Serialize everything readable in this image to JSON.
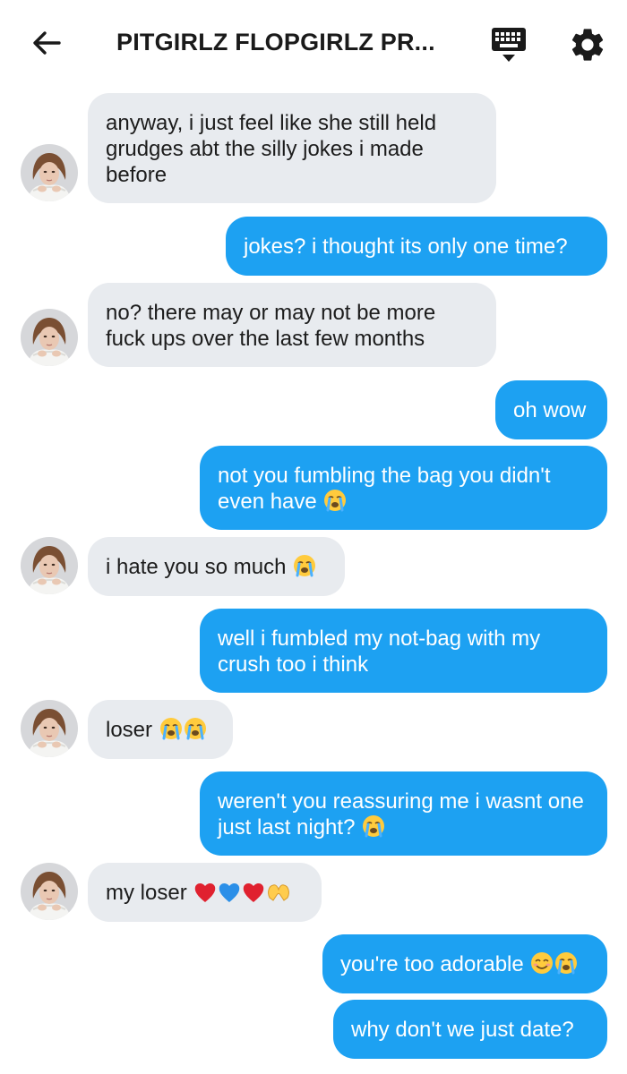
{
  "header": {
    "title": "PITGIRLZ FLOPGIRLZ PR...",
    "back_icon": "arrow-left-icon",
    "keyboard_icon": "keyboard-icon",
    "settings_icon": "gear-icon"
  },
  "colors": {
    "incoming_bubble": "#e8ebef",
    "outgoing_bubble": "#1da1f2"
  },
  "messages": [
    {
      "from": "them",
      "text": "anyway, i just feel like she still held grudges abt the silly jokes i made before"
    },
    {
      "from": "me",
      "text": "jokes? i thought its only one time?"
    },
    {
      "from": "them",
      "text": "no? there may or may not be more fuck ups over the last few months"
    },
    {
      "from": "me",
      "text": "oh wow"
    },
    {
      "from": "me",
      "text": "not you fumbling the bag you didn't even have",
      "emojis": [
        "loudly-crying-face"
      ]
    },
    {
      "from": "them",
      "text": "i hate you so much",
      "emojis": [
        "loudly-crying-face"
      ]
    },
    {
      "from": "me",
      "text": "well i fumbled my not-bag with my crush too i think"
    },
    {
      "from": "them",
      "text": "loser",
      "emojis": [
        "loudly-crying-face",
        "loudly-crying-face"
      ]
    },
    {
      "from": "me",
      "text": "weren't you reassuring me i wasnt one just last night?",
      "emojis": [
        "loudly-crying-face"
      ]
    },
    {
      "from": "them",
      "text": "my loser",
      "emojis": [
        "red-heart",
        "blue-heart",
        "red-heart",
        "heart-hands"
      ]
    },
    {
      "from": "me",
      "text": "you're too adorable",
      "emojis": [
        "smiling-face-with-smiling-eyes",
        "loudly-crying-face"
      ]
    },
    {
      "from": "me",
      "text": "why don't we just date?"
    }
  ]
}
